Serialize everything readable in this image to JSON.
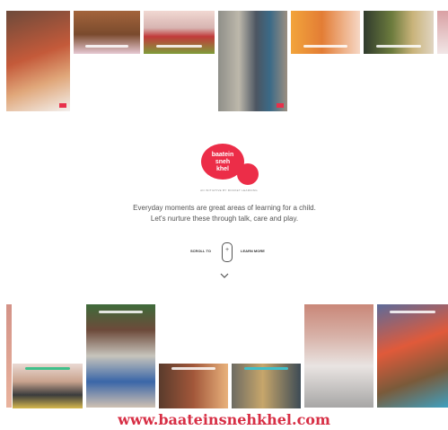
{
  "brand": {
    "logo_line1": "baatein",
    "logo_line2": "sneh",
    "logo_line3": "khel",
    "sub_tagline": "AN INITIATIVE BY ROCKET LEARNING",
    "color": "#ec2d48"
  },
  "hero": {
    "tagline_line1": "Everyday moments are great areas of learning for a child.",
    "tagline_line2": "Let's nurture these through talk, care and play."
  },
  "scroll": {
    "left_label": "SCROLL TO",
    "right_label": "LEARN MORE"
  },
  "footer": {
    "url": "www.baateinsnehkhel.com"
  },
  "icons": [
    "mouse-icon",
    "chevron-down-icon"
  ]
}
